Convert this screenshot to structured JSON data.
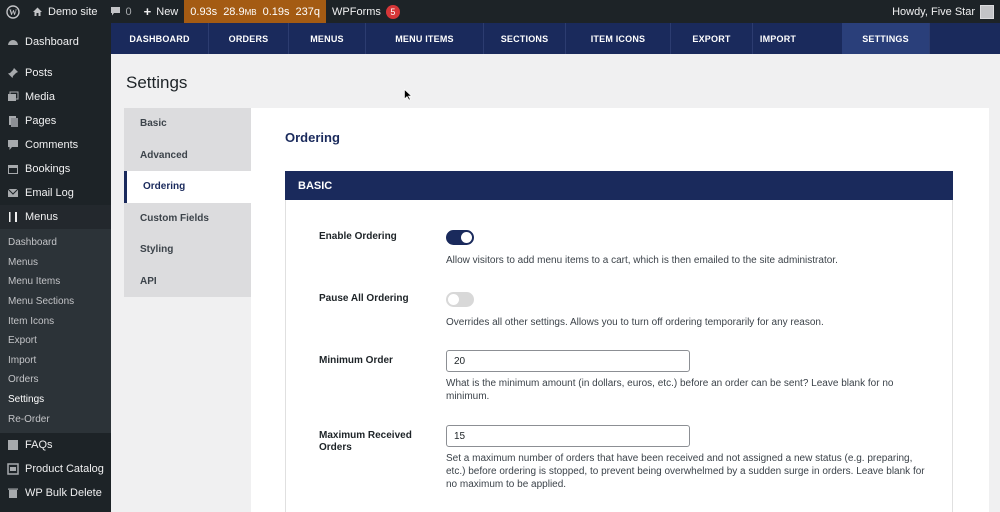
{
  "adminbar": {
    "site_name": "Demo site",
    "comments_count": "0",
    "new_label": "New",
    "qm": [
      "0.93s",
      "28.9",
      "MB",
      "0.19s",
      "237q"
    ],
    "wpforms_label": "WPForms",
    "wpforms_badge": "5",
    "howdy": "Howdy, Five Star"
  },
  "sidebar": {
    "items": [
      {
        "label": "Dashboard",
        "icon": "dashboard-icon"
      },
      {
        "label": "Posts",
        "icon": "pin-icon"
      },
      {
        "label": "Media",
        "icon": "media-icon"
      },
      {
        "label": "Pages",
        "icon": "pages-icon"
      },
      {
        "label": "Comments",
        "icon": "comments-icon"
      },
      {
        "label": "Bookings",
        "icon": "calendar-icon"
      },
      {
        "label": "Email Log",
        "icon": "email-icon"
      },
      {
        "label": "Menus",
        "icon": "fork-knife-icon"
      }
    ],
    "submenu": [
      "Dashboard",
      "Menus",
      "Menu Items",
      "Menu Sections",
      "Item Icons",
      "Export",
      "Import",
      "Orders",
      "Settings",
      "Re-Order"
    ],
    "bottom_items": [
      {
        "label": "FAQs",
        "icon": "faq-icon"
      },
      {
        "label": "Product Catalog",
        "icon": "catalog-icon"
      },
      {
        "label": "WP Bulk Delete",
        "icon": "trash-icon"
      }
    ]
  },
  "tabs": [
    "DASHBOARD",
    "ORDERS",
    "MENUS",
    "MENU ITEMS",
    "SECTIONS",
    "ITEM ICONS",
    "EXPORT",
    "IMPORT",
    "SETTINGS"
  ],
  "active_tab": "SETTINGS",
  "page_title": "Settings",
  "settings_nav": [
    "Basic",
    "Advanced",
    "Ordering",
    "Custom Fields",
    "Styling",
    "API"
  ],
  "active_settings_nav": "Ordering",
  "panel": {
    "heading": "Ordering",
    "section_title": "BASIC",
    "fields": {
      "enable_ordering": {
        "label": "Enable Ordering",
        "enabled": true,
        "description": "Allow visitors to add menu items to a cart, which is then emailed to the site administrator."
      },
      "pause_ordering": {
        "label": "Pause All Ordering",
        "enabled": false,
        "description": "Overrides all other settings. Allows you to turn off ordering temporarily for any reason."
      },
      "minimum_order": {
        "label": "Minimum Order",
        "value": "20",
        "description": "What is the minimum amount (in dollars, euros, etc.) before an order can be sent? Leave blank for no minimum."
      },
      "maximum_received": {
        "label": "Maximum Received Orders",
        "value": "15",
        "description": "Set a maximum number of orders that have been received and not assigned a new status (e.g. preparing, etc.) before ordering is stopped, to prevent being overwhelmed by a sudden surge in orders. Leave blank for no maximum to be applied."
      }
    }
  },
  "colors": {
    "admin_dark": "#1d2327",
    "brand_navy": "#1a2a5c",
    "qm_orange": "#a45b13",
    "badge_red": "#d63638"
  }
}
